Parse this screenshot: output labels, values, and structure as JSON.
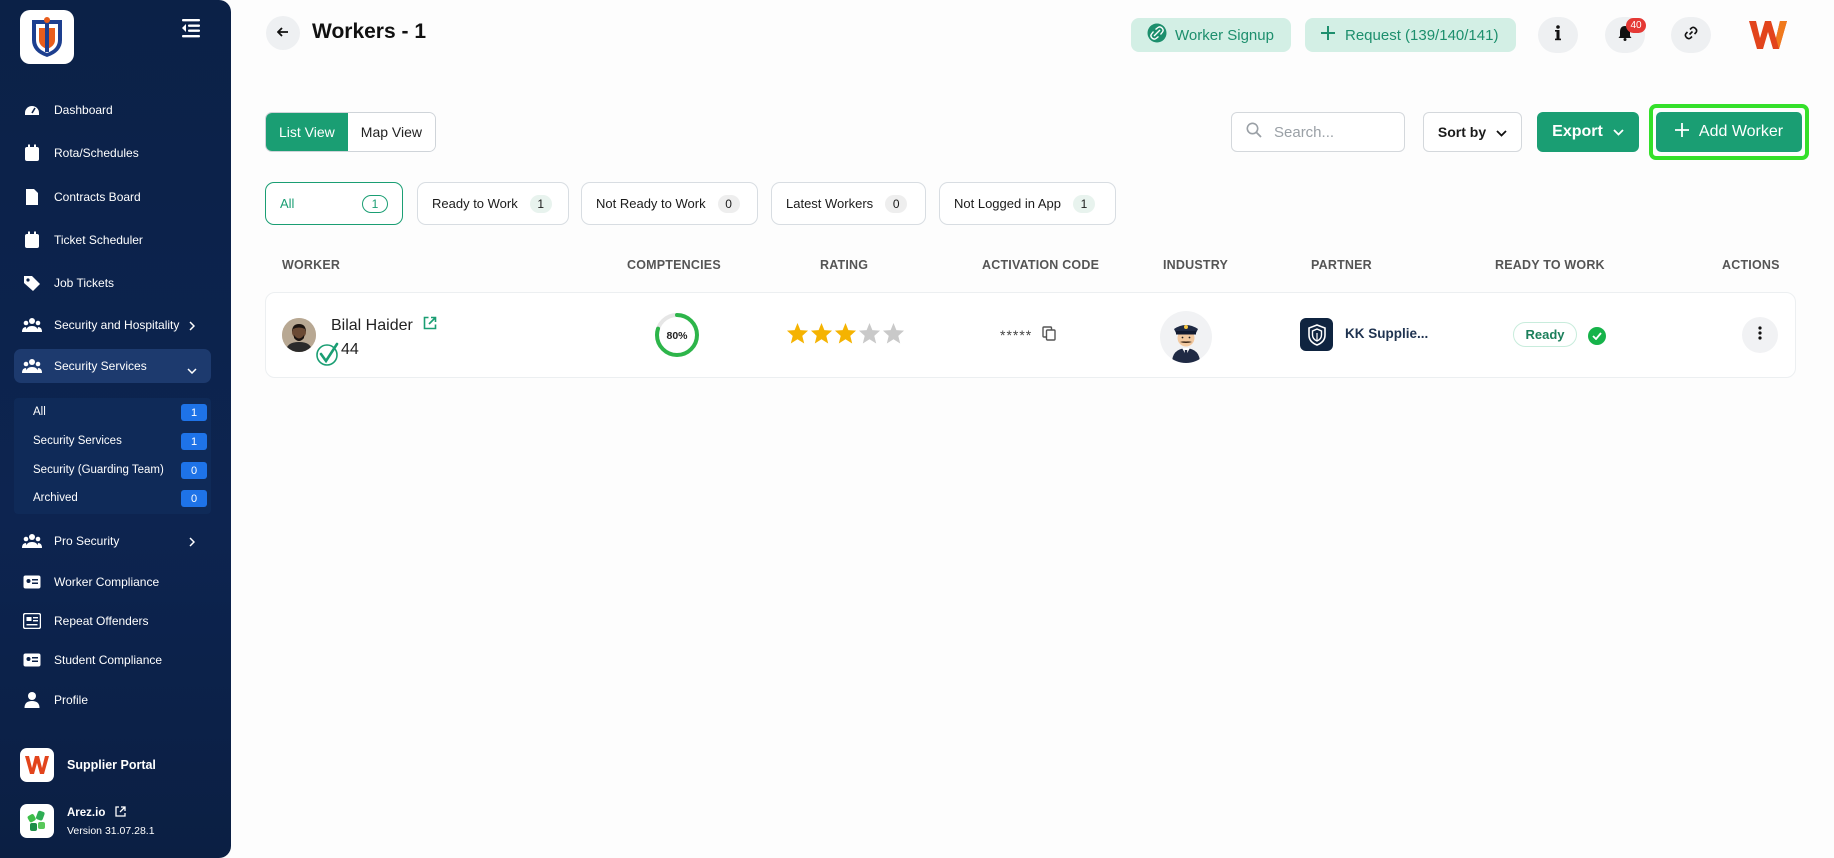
{
  "page": {
    "title": "Workers - 1"
  },
  "header": {
    "worker_signup": "Worker Signup",
    "request": "Request (139/140/141)",
    "notifications_count": "40"
  },
  "sidebar": {
    "items": [
      {
        "label": "Dashboard",
        "icon": "dashboard-icon"
      },
      {
        "label": "Rota/Schedules",
        "icon": "calendar-icon"
      },
      {
        "label": "Contracts Board",
        "icon": "document-icon"
      },
      {
        "label": "Ticket Scheduler",
        "icon": "calendar-icon"
      },
      {
        "label": "Job Tickets",
        "icon": "tag-icon"
      },
      {
        "label": "Security and Hospitality",
        "icon": "users-icon"
      },
      {
        "label": "Security Services",
        "icon": "users-icon"
      },
      {
        "label": "Pro Security",
        "icon": "users-icon"
      },
      {
        "label": "Worker Compliance",
        "icon": "id-card-icon"
      },
      {
        "label": "Repeat Offenders",
        "icon": "report-icon"
      },
      {
        "label": "Student Compliance",
        "icon": "id-card-icon"
      },
      {
        "label": "Profile",
        "icon": "user-icon"
      }
    ],
    "sub_items": [
      {
        "label": "All",
        "count": "1"
      },
      {
        "label": "Security Services",
        "count": "1"
      },
      {
        "label": "Security (Guarding Team)",
        "count": "0"
      },
      {
        "label": "Archived",
        "count": "0"
      }
    ],
    "portal_label": "Supplier Portal",
    "arez_name": "Arez.io",
    "version": "Version 31.07.28.1"
  },
  "toolbar": {
    "list_view": "List View",
    "map_view": "Map View",
    "search_placeholder": "Search...",
    "sort_by": "Sort by",
    "export": "Export",
    "add_worker": "Add Worker"
  },
  "filters": [
    {
      "label": "All",
      "count": "1"
    },
    {
      "label": "Ready to Work",
      "count": "1"
    },
    {
      "label": "Not Ready to Work",
      "count": "0"
    },
    {
      "label": "Latest Workers",
      "count": "0"
    },
    {
      "label": "Not Logged in App",
      "count": "1"
    }
  ],
  "table": {
    "headers": {
      "worker": "WORKER",
      "competencies": "COMPTENCIES",
      "rating": "RATING",
      "activation_code": "ACTIVATION CODE",
      "industry": "INDUSTRY",
      "partner": "PARTNER",
      "ready_to_work": "READY TO WORK",
      "actions": "ACTIONS"
    },
    "rows": [
      {
        "name": "Bilal Haider",
        "id": "44",
        "competency": "80%",
        "competency_fraction": 0.8,
        "rating": 3,
        "rating_max": 5,
        "activation_code": "*****",
        "partner": "KK Supplie...",
        "status": "Ready"
      }
    ]
  },
  "colors": {
    "accent": "#1a9e73",
    "highlight": "#34e02a",
    "star": "#f5b301",
    "star_empty": "#c9c9c9",
    "sidebar_bg": "#0b2147"
  }
}
